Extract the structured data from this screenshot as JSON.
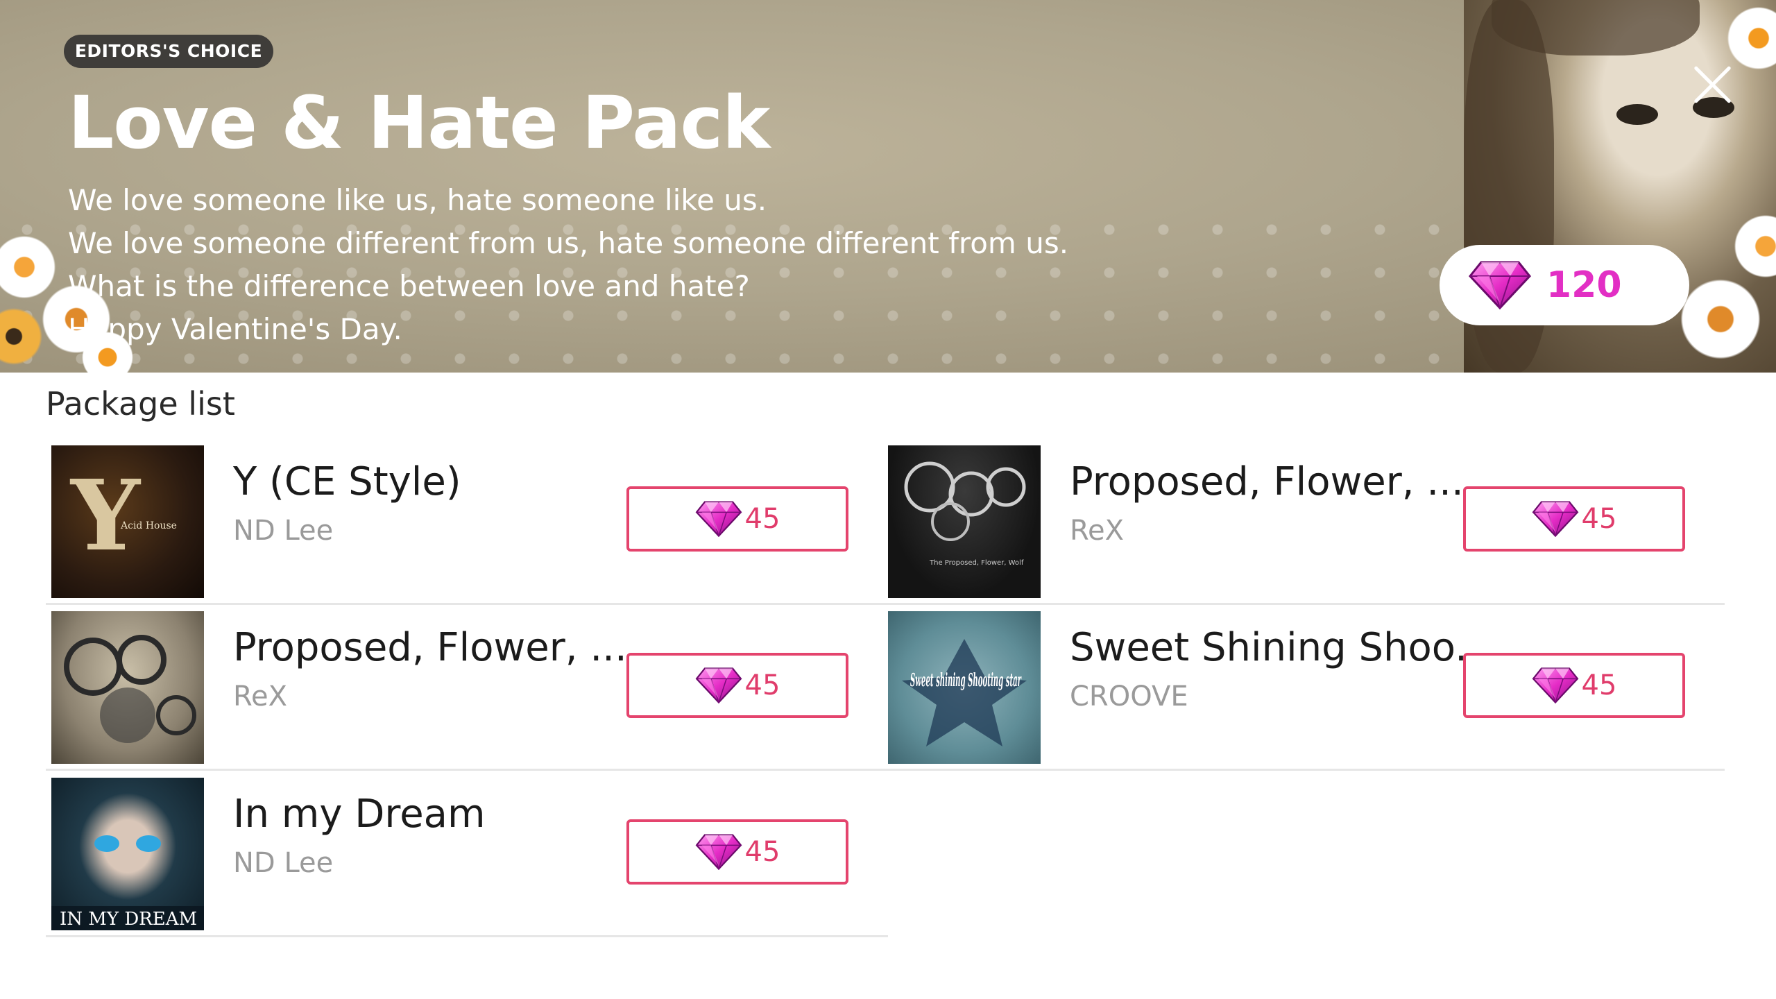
{
  "banner": {
    "badge": "EDITORS'S CHOICE",
    "title": "Love & Hate Pack",
    "description": [
      "We love someone like us, hate someone like us.",
      "We love someone different from us, hate someone different from us.",
      "What is the difference between love and hate?",
      "Happy Valentine's Day."
    ],
    "price": "120"
  },
  "section_title": "Package list",
  "colors": {
    "accent": "#e22fc4",
    "button_border": "#e4446d",
    "price_text": "#e03c6b"
  },
  "icons": {
    "close": "close-icon",
    "gem": "gem-icon"
  },
  "songs": [
    {
      "title": "Y (CE Style)",
      "artist": "ND Lee",
      "price": "45",
      "cover_text": "Y",
      "cover_sub": "Acid House"
    },
    {
      "title": "Proposed, Flower, ...",
      "artist": "ReX",
      "price": "45",
      "cover_text": "The Proposed, Flower, Wolf"
    },
    {
      "title": "Proposed, Flower, ...",
      "artist": "ReX",
      "price": "45",
      "cover_text": ""
    },
    {
      "title": "Sweet Shining Shoo...",
      "artist": "CROOVE",
      "price": "45",
      "cover_text": "Sweet shining Shooting star"
    },
    {
      "title": "In my Dream",
      "artist": "ND Lee",
      "price": "45",
      "cover_text": "IN MY DREAM"
    }
  ]
}
